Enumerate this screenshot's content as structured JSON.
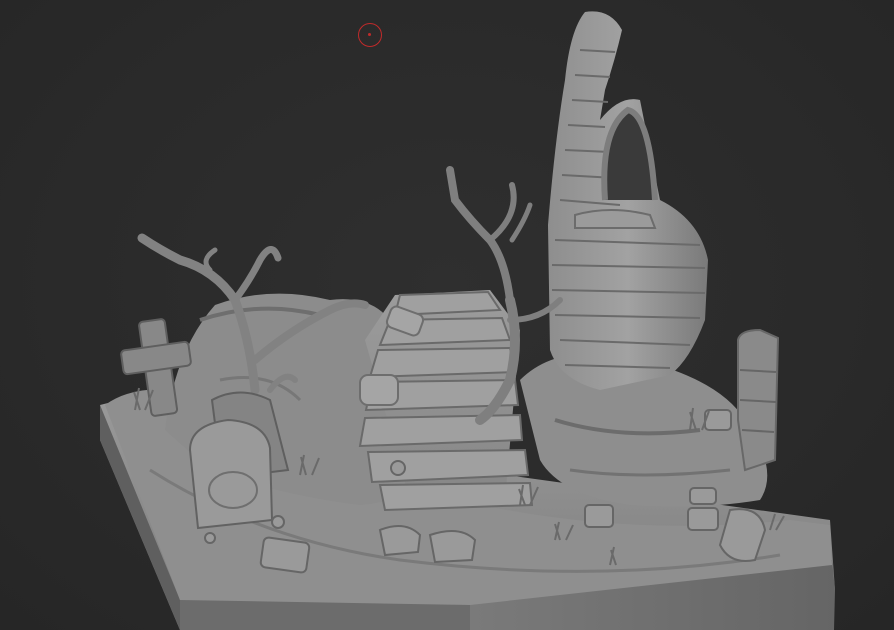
{
  "viewport": {
    "label": "",
    "background_color": "#2b2b2b"
  },
  "brush_cursor": {
    "color": "#c02a2a",
    "icon": "circle-brush-cursor-icon"
  },
  "model": {
    "material_color": "#8a8a8a",
    "parts": [
      "base-platform",
      "stone-staircase",
      "ruined-tower-with-arch",
      "dead-tree-left",
      "dead-tree-center",
      "tombstone",
      "cross-grave-marker",
      "stone-pillar-right",
      "rocks-and-skulls"
    ]
  }
}
